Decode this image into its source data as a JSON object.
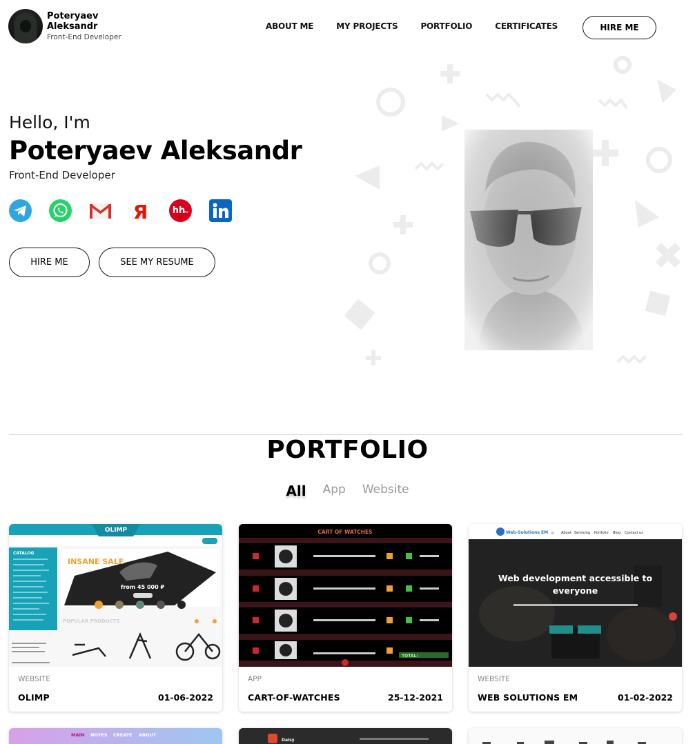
{
  "header": {
    "brand_name": "Poteryaev Aleksandr",
    "brand_role": "Front-End Developer",
    "nav": [
      "ABOUT ME",
      "MY PROJECTS",
      "PORTFOLIO",
      "CERTIFICATES"
    ],
    "hire_label": "HIRE ME"
  },
  "hero": {
    "greeting": "Hello, I'm",
    "name": "Poteryaev Aleksandr",
    "role": "Front-End Developer",
    "socials": [
      "telegram-icon",
      "whatsapp-icon",
      "gmail-icon",
      "yandex-icon",
      "hh-icon",
      "linkedin-icon"
    ],
    "hire_label": "HIRE ME",
    "resume_label": "SEE MY RESUME"
  },
  "portfolio": {
    "title": "PORTFOLIO",
    "filters": [
      "All",
      "App",
      "Website"
    ],
    "active_filter": "All",
    "cards": [
      {
        "category": "WEBSITE",
        "title": "OLIMP",
        "date": "01-06-2022",
        "thumb": {
          "brand": "OLIMP",
          "catalog": "CATALOG",
          "promo": "INSANE SALE",
          "price": "from 45 000 ₽",
          "section": "POPULAR PRODUCTS"
        }
      },
      {
        "category": "APP",
        "title": "CART-OF-WATCHES",
        "date": "25-12-2021",
        "thumb": {
          "header": "CART OF WATCHES",
          "total": "TOTAL:"
        }
      },
      {
        "category": "WEBSITE",
        "title": "WEB SOLUTIONS EM",
        "date": "01-02-2022",
        "thumb": {
          "logo": "Web-Solutions EM",
          "nav": [
            "About",
            "Servicing",
            "Portfolio",
            "Blog",
            "Contact us"
          ],
          "headline": "Web development accessible to everyone"
        }
      }
    ],
    "next_row": [
      {
        "thumb": {
          "nav": [
            "MAIN",
            "NOTES",
            "CREATE",
            "ABOUT"
          ]
        }
      },
      {
        "thumb": {
          "logo": "Daisy"
        }
      },
      {
        "thumb": {}
      }
    ]
  },
  "colors": {
    "accent_teal": "#17a2b8",
    "olimp_orange": "#f0a030",
    "watches_bg": "#3a1418",
    "telegram": "#2ea6df",
    "whatsapp": "#25d366",
    "linkedin": "#0a66c2",
    "hh": "#d6001c",
    "yandex": "#e61400"
  }
}
